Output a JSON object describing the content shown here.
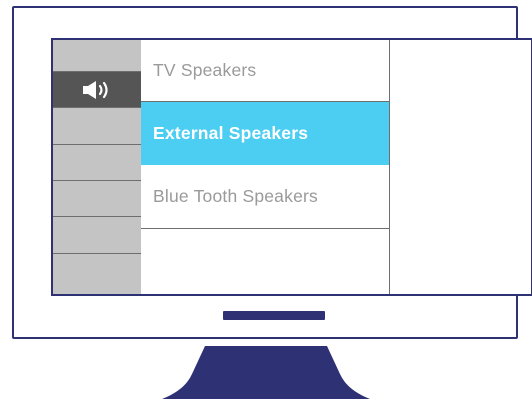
{
  "colors": {
    "frame": "#2e3275",
    "sidebar": "#c4c4c4",
    "sidebar_active": "#555555",
    "selection": "#4ccdf2",
    "item_text": "#9a9a9a",
    "selected_text": "#ffffff"
  },
  "sidebar": {
    "active_icon": "speaker-volume-icon"
  },
  "menu": {
    "items": [
      {
        "label": "TV Speakers",
        "selected": false
      },
      {
        "label": "External Speakers",
        "selected": true
      },
      {
        "label": "Blue Tooth Speakers",
        "selected": false
      }
    ]
  }
}
